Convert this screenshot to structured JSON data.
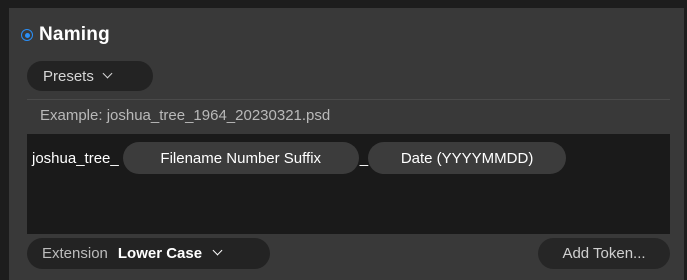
{
  "section": {
    "title": "Naming",
    "enabled": true,
    "accent_color": "#2a8ff7"
  },
  "presets": {
    "label": "Presets",
    "icon": "chevron-down-icon"
  },
  "example": {
    "text": "Example: joshua_tree_1964_20230321.psd"
  },
  "tokens": {
    "prefix": "joshua_tree_",
    "items": [
      {
        "label": "Filename Number Suffix"
      },
      {
        "label": "Date (YYYYMMDD)"
      }
    ],
    "separator": "_"
  },
  "extension": {
    "label": "Extension",
    "value": "Lower Case",
    "icon": "chevron-down-icon"
  },
  "add_token": {
    "label": "Add Token..."
  }
}
